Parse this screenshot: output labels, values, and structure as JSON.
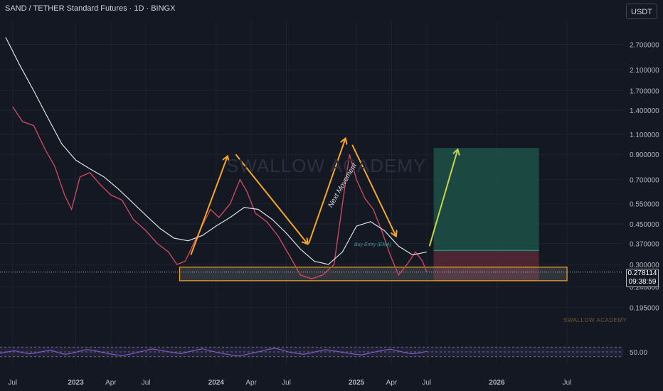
{
  "header": {
    "title": "SAND / TETHER Standard Futures · 1D · BINGX",
    "currency_badge": "USDT"
  },
  "price_tag": {
    "price": "0.278114",
    "countdown": "09:38:59"
  },
  "watermark": "SWALLOW ACADEMY",
  "footer_watermark": "SWALLOW ACADEMY",
  "annotations": {
    "buy_entry": "Buy Entry (EMA)",
    "next_move": "Next Movement"
  },
  "colors": {
    "background": "#141823",
    "arrow": "#f5a623",
    "target_zone": "#1e5a4c",
    "stop_zone": "#5a2a36",
    "support_box": "#f5a623",
    "rsi_line": "#7e57c2"
  },
  "chart_data": [
    {
      "type": "line",
      "title": "",
      "ylabel": "",
      "scale": "log",
      "y_ticks": [
        "2.700000",
        "2.100000",
        "1.700000",
        "1.400000",
        "1.100000",
        "0.900000",
        "0.700000",
        "0.550000",
        "0.450000",
        "0.370000",
        "0.300000",
        "0.240000",
        "0.195000"
      ],
      "x_ticks": [
        "Jul",
        "2023",
        "Apr",
        "Jul",
        "2024",
        "Apr",
        "Jul",
        "2025",
        "Apr",
        "Jul",
        "2026",
        "Jul"
      ],
      "ylim": [
        0.17,
        3.4
      ],
      "series": [
        {
          "values": [
            [
              2022.55,
              1.45
            ],
            [
              2022.62,
              1.25
            ],
            [
              2022.7,
              1.2
            ],
            [
              2022.78,
              0.95
            ],
            [
              2022.85,
              0.8
            ],
            [
              2022.92,
              0.6
            ],
            [
              2022.97,
              0.52
            ],
            [
              2023.03,
              0.72
            ],
            [
              2023.1,
              0.75
            ],
            [
              2023.18,
              0.66
            ],
            [
              2023.25,
              0.6
            ],
            [
              2023.33,
              0.57
            ],
            [
              2023.41,
              0.47
            ],
            [
              2023.5,
              0.42
            ],
            [
              2023.58,
              0.37
            ],
            [
              2023.66,
              0.34
            ],
            [
              2023.72,
              0.3
            ],
            [
              2023.78,
              0.31
            ],
            [
              2023.84,
              0.37
            ],
            [
              2023.9,
              0.44
            ],
            [
              2023.96,
              0.52
            ],
            [
              2024.02,
              0.48
            ],
            [
              2024.1,
              0.55
            ],
            [
              2024.17,
              0.7
            ],
            [
              2024.22,
              0.62
            ],
            [
              2024.28,
              0.5
            ],
            [
              2024.36,
              0.46
            ],
            [
              2024.44,
              0.4
            ],
            [
              2024.52,
              0.33
            ],
            [
              2024.6,
              0.27
            ],
            [
              2024.68,
              0.26
            ],
            [
              2024.76,
              0.27
            ],
            [
              2024.84,
              0.3
            ],
            [
              2024.9,
              0.55
            ],
            [
              2024.95,
              0.9
            ],
            [
              2025.0,
              0.7
            ],
            [
              2025.06,
              0.58
            ],
            [
              2025.12,
              0.52
            ],
            [
              2025.18,
              0.42
            ],
            [
              2025.24,
              0.33
            ],
            [
              2025.3,
              0.27
            ],
            [
              2025.36,
              0.3
            ],
            [
              2025.42,
              0.34
            ],
            [
              2025.47,
              0.31
            ],
            [
              2025.5,
              0.278
            ]
          ]
        },
        {
          "values": [
            [
              2022.5,
              2.9
            ],
            [
              2022.6,
              2.2
            ],
            [
              2022.7,
              1.7
            ],
            [
              2022.8,
              1.3
            ],
            [
              2022.9,
              1.0
            ],
            [
              2023.0,
              0.85
            ],
            [
              2023.1,
              0.78
            ],
            [
              2023.2,
              0.72
            ],
            [
              2023.3,
              0.64
            ],
            [
              2023.4,
              0.56
            ],
            [
              2023.5,
              0.49
            ],
            [
              2023.6,
              0.43
            ],
            [
              2023.7,
              0.39
            ],
            [
              2023.8,
              0.38
            ],
            [
              2023.9,
              0.4
            ],
            [
              2024.0,
              0.44
            ],
            [
              2024.1,
              0.48
            ],
            [
              2024.2,
              0.53
            ],
            [
              2024.3,
              0.52
            ],
            [
              2024.4,
              0.47
            ],
            [
              2024.5,
              0.41
            ],
            [
              2024.6,
              0.35
            ],
            [
              2024.7,
              0.31
            ],
            [
              2024.8,
              0.3
            ],
            [
              2024.9,
              0.34
            ],
            [
              2025.0,
              0.44
            ],
            [
              2025.1,
              0.46
            ],
            [
              2025.2,
              0.42
            ],
            [
              2025.3,
              0.36
            ],
            [
              2025.4,
              0.33
            ],
            [
              2025.5,
              0.34
            ]
          ]
        }
      ],
      "zones": {
        "support_box": [
          0.255,
          0.292
        ],
        "target_zone": [
          0.345,
          0.96
        ],
        "stop_zone": [
          0.255,
          0.345
        ]
      }
    },
    {
      "type": "line",
      "title": "",
      "y_ticks": [
        "50.00"
      ],
      "ylim": [
        0,
        100
      ],
      "levels": [
        30,
        50,
        70
      ],
      "series": [
        {
          "values": [
            44,
            50,
            55,
            48,
            42,
            46,
            52,
            58,
            47,
            40,
            45,
            53,
            60,
            56,
            49,
            43,
            38,
            35,
            41,
            48,
            55,
            62,
            58,
            52,
            47,
            43,
            50,
            57,
            63,
            55,
            48,
            42,
            37,
            33,
            39,
            46,
            52,
            60,
            65,
            58,
            49,
            44,
            40,
            46,
            53,
            59,
            55,
            50,
            45,
            41,
            38,
            44,
            51,
            57,
            61,
            54,
            47,
            42,
            46,
            52
          ]
        }
      ]
    }
  ]
}
